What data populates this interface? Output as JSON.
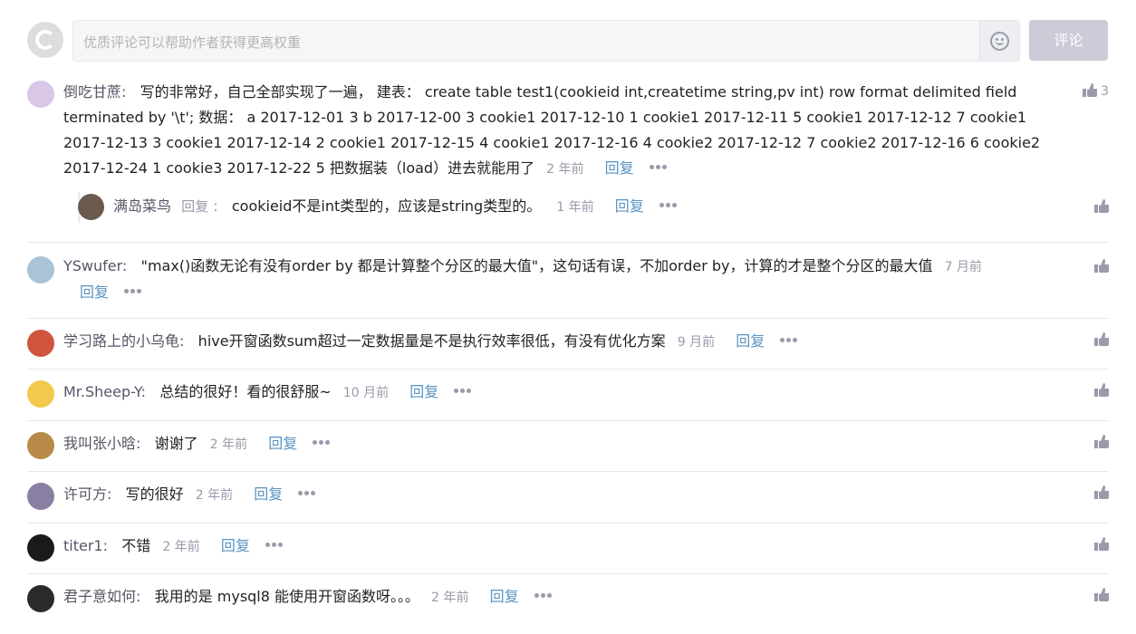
{
  "editor": {
    "placeholder": "优质评论可以帮助作者获得更高权重",
    "submit_label": "评论"
  },
  "comments": [
    {
      "user": "倒吃甘蔗:",
      "text": "写的非常好，自己全部实现了一遍， 建表： create table test1(cookieid int,createtime string,pv int) row format delimited field terminated by '\\t'; 数据： a 2017-12-01 3 b 2017-12-00 3 cookie1 2017-12-10 1 cookie1 2017-12-11 5 cookie1 2017-12-12 7 cookie1 2017-12-13 3 cookie1 2017-12-14 2 cookie1 2017-12-15 4 cookie1 2017-12-16 4 cookie2 2017-12-12 7 cookie2 2017-12-16 6 cookie2 2017-12-24 1 cookie3 2017-12-22 5 把数据装（load）进去就能用了",
      "time": "2 年前",
      "reply": "回复",
      "likes": "3",
      "avatar_color": "#d9c7e8"
    },
    {
      "user": "YSwufer:",
      "text": "\"max()函数无论有没有order by 都是计算整个分区的最大值\"，这句话有误，不加order by，计算的才是整个分区的最大值",
      "time": "7 月前",
      "reply": "回复",
      "likes": "",
      "avatar_color": "#a8c4d6"
    },
    {
      "user": "学习路上的小乌龟:",
      "text": "hive开窗函数sum超过一定数据量是不是执行效率很低，有没有优化方案",
      "time": "9 月前",
      "reply": "回复",
      "likes": "",
      "avatar_color": "#d0553f"
    },
    {
      "user": "Mr.Sheep-Y:",
      "text": "总结的很好！看的很舒服~",
      "time": "10 月前",
      "reply": "回复",
      "likes": "",
      "avatar_color": "#f2c94c"
    },
    {
      "user": "我叫张小晗:",
      "text": "谢谢了",
      "time": "2 年前",
      "reply": "回复",
      "likes": "",
      "avatar_color": "#b78a47"
    },
    {
      "user": "许可方:",
      "text": "写的很好",
      "time": "2 年前",
      "reply": "回复",
      "likes": "",
      "avatar_color": "#8a7fa3"
    },
    {
      "user": "titer1:",
      "text": "不错",
      "time": "2 年前",
      "reply": "回复",
      "likes": "",
      "avatar_color": "#1a1a1a"
    },
    {
      "user": "君子意如何:",
      "text": "我用的是 mysql8 能使用开窗函数呀。。。",
      "time": "2 年前",
      "reply": "回复",
      "likes": "",
      "avatar_color": "#2b2b2b"
    }
  ],
  "sub_reply": {
    "user": "满岛菜鸟",
    "reply_word": "回复",
    "text": "cookieid不是int类型的，应该是string类型的。",
    "time": "1 年前",
    "reply": "回复",
    "avatar_color": "#6b5a4e"
  },
  "icons": {
    "logo": "csdn-logo-icon",
    "emoji": "emoji-icon",
    "like": "thumbs-up-icon",
    "more": "more-dots-icon"
  }
}
